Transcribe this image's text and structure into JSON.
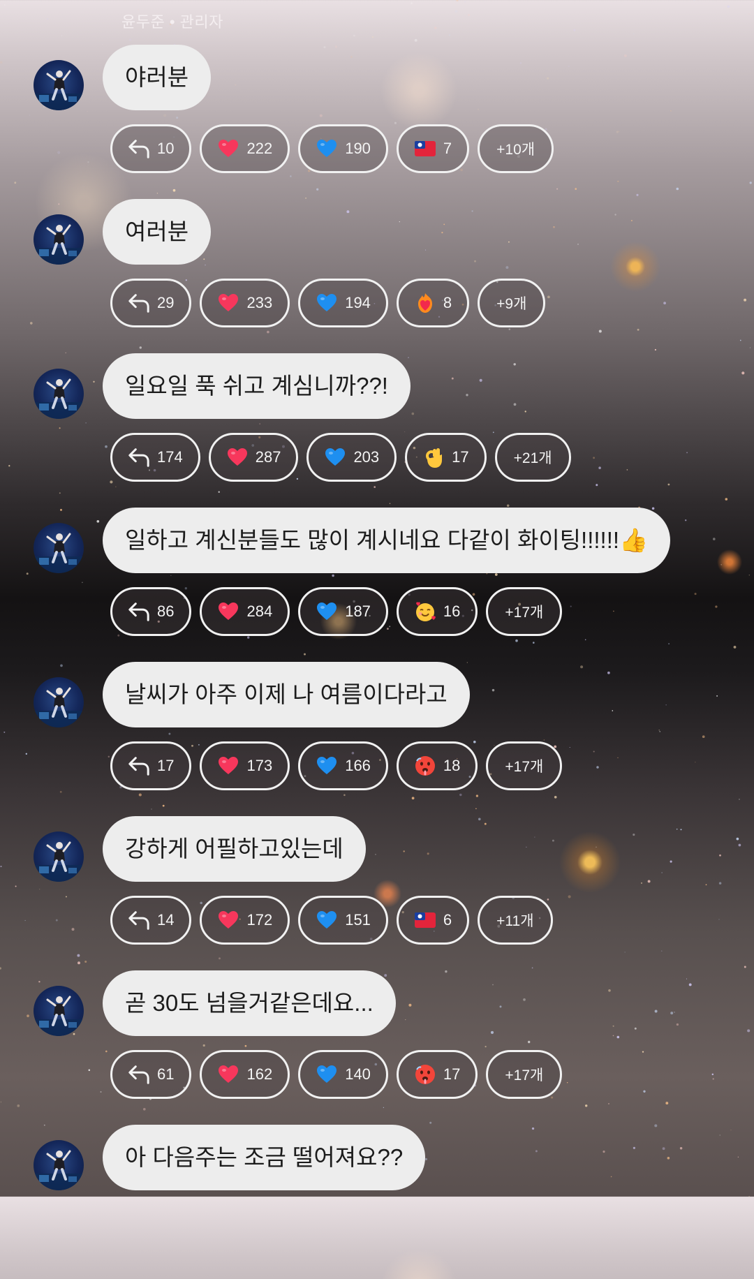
{
  "header": {
    "author_line": "윤두준 • 관리자"
  },
  "messages": [
    {
      "text": "야러분",
      "reactions": {
        "reply": "10",
        "red_heart": "222",
        "blue_heart": "190",
        "third": {
          "icon": "taiwan-flag-icon",
          "count": "7"
        },
        "more": "+10개"
      }
    },
    {
      "text": "여러분",
      "reactions": {
        "reply": "29",
        "red_heart": "233",
        "blue_heart": "194",
        "third": {
          "icon": "heart-on-fire-icon",
          "count": "8"
        },
        "more": "+9개"
      }
    },
    {
      "text": "일요일 푹 쉬고 계심니까??!",
      "reactions": {
        "reply": "174",
        "red_heart": "287",
        "blue_heart": "203",
        "third": {
          "icon": "ok-hand-icon",
          "count": "17"
        },
        "more": "+21개"
      }
    },
    {
      "text": "일하고 계신분들도 많이 계시네요 다같이 화이팅!!!!!!👍",
      "reactions": {
        "reply": "86",
        "red_heart": "284",
        "blue_heart": "187",
        "third": {
          "icon": "smiling-face-with-hearts-icon",
          "count": "16"
        },
        "more": "+17개"
      }
    },
    {
      "text": "날씨가 아주 이제 나 여름이다라고",
      "reactions": {
        "reply": "17",
        "red_heart": "173",
        "blue_heart": "166",
        "third": {
          "icon": "hot-face-icon",
          "count": "18"
        },
        "more": "+17개"
      }
    },
    {
      "text": "강하게 어필하고있는데",
      "reactions": {
        "reply": "14",
        "red_heart": "172",
        "blue_heart": "151",
        "third": {
          "icon": "taiwan-flag-icon",
          "count": "6"
        },
        "more": "+11개"
      }
    },
    {
      "text": "곧 30도 넘을거같은데요...",
      "reactions": {
        "reply": "61",
        "red_heart": "162",
        "blue_heart": "140",
        "third": {
          "icon": "hot-face-icon",
          "count": "17"
        },
        "more": "+17개"
      }
    },
    {
      "text": "아 다음주는 조금 떨어져요??"
    }
  ],
  "colors": {
    "bubble_bg": "#ededed",
    "bubble_text": "#1c1c1c",
    "chip_border": "#f1f1f1",
    "red_heart": "#f7375c",
    "blue_heart": "#1e8ff0"
  }
}
